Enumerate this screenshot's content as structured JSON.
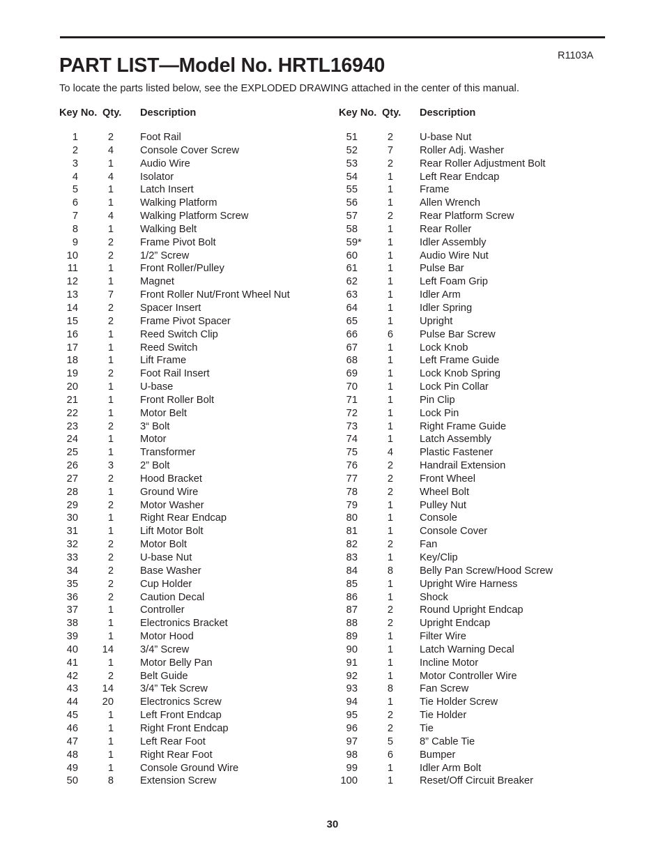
{
  "document": {
    "title": "PART LIST—Model No. HRTL16940",
    "revision": "R1103A",
    "intro": "To locate the parts listed below, see the EXPLODED DRAWING attached in the center of this manual.",
    "page_number": "30"
  },
  "table": {
    "headers": {
      "key_no": "Key No.",
      "qty": "Qty.",
      "description": "Description"
    },
    "left_column": [
      {
        "key": "1",
        "star": "",
        "qty": "2",
        "description": "Foot Rail"
      },
      {
        "key": "2",
        "star": "",
        "qty": "4",
        "description": "Console Cover Screw"
      },
      {
        "key": "3",
        "star": "",
        "qty": "1",
        "description": "Audio Wire"
      },
      {
        "key": "4",
        "star": "",
        "qty": "4",
        "description": "Isolator"
      },
      {
        "key": "5",
        "star": "",
        "qty": "1",
        "description": "Latch Insert"
      },
      {
        "key": "6",
        "star": "",
        "qty": "1",
        "description": "Walking Platform"
      },
      {
        "key": "7",
        "star": "",
        "qty": "4",
        "description": "Walking Platform Screw"
      },
      {
        "key": "8",
        "star": "",
        "qty": "1",
        "description": "Walking Belt"
      },
      {
        "key": "9",
        "star": "",
        "qty": "2",
        "description": "Frame Pivot Bolt"
      },
      {
        "key": "10",
        "star": "",
        "qty": "2",
        "description": "1/2” Screw"
      },
      {
        "key": "11",
        "star": "",
        "qty": "1",
        "description": "Front Roller/Pulley"
      },
      {
        "key": "12",
        "star": "",
        "qty": "1",
        "description": "Magnet"
      },
      {
        "key": "13",
        "star": "",
        "qty": "7",
        "description": "Front Roller Nut/Front Wheel Nut"
      },
      {
        "key": "14",
        "star": "",
        "qty": "2",
        "description": "Spacer Insert"
      },
      {
        "key": "15",
        "star": "",
        "qty": "2",
        "description": "Frame Pivot Spacer"
      },
      {
        "key": "16",
        "star": "",
        "qty": "1",
        "description": "Reed Switch Clip"
      },
      {
        "key": "17",
        "star": "",
        "qty": "1",
        "description": "Reed Switch"
      },
      {
        "key": "18",
        "star": "",
        "qty": "1",
        "description": "Lift Frame"
      },
      {
        "key": "19",
        "star": "",
        "qty": "2",
        "description": "Foot Rail Insert"
      },
      {
        "key": "20",
        "star": "",
        "qty": "1",
        "description": "U-base"
      },
      {
        "key": "21",
        "star": "",
        "qty": "1",
        "description": "Front Roller Bolt"
      },
      {
        "key": "22",
        "star": "",
        "qty": "1",
        "description": "Motor Belt"
      },
      {
        "key": "23",
        "star": "",
        "qty": "2",
        "description": "3“ Bolt"
      },
      {
        "key": "24",
        "star": "",
        "qty": "1",
        "description": "Motor"
      },
      {
        "key": "25",
        "star": "",
        "qty": "1",
        "description": "Transformer"
      },
      {
        "key": "26",
        "star": "",
        "qty": "3",
        "description": "2” Bolt"
      },
      {
        "key": "27",
        "star": "",
        "qty": "2",
        "description": "Hood Bracket"
      },
      {
        "key": "28",
        "star": "",
        "qty": "1",
        "description": "Ground Wire"
      },
      {
        "key": "29",
        "star": "",
        "qty": "2",
        "description": "Motor Washer"
      },
      {
        "key": "30",
        "star": "",
        "qty": "1",
        "description": "Right Rear Endcap"
      },
      {
        "key": "31",
        "star": "",
        "qty": "1",
        "description": "Lift Motor Bolt"
      },
      {
        "key": "32",
        "star": "",
        "qty": "2",
        "description": "Motor Bolt"
      },
      {
        "key": "33",
        "star": "",
        "qty": "2",
        "description": "U-base Nut"
      },
      {
        "key": "34",
        "star": "",
        "qty": "2",
        "description": "Base Washer"
      },
      {
        "key": "35",
        "star": "",
        "qty": "2",
        "description": "Cup Holder"
      },
      {
        "key": "36",
        "star": "",
        "qty": "2",
        "description": "Caution Decal"
      },
      {
        "key": "37",
        "star": "",
        "qty": "1",
        "description": "Controller"
      },
      {
        "key": "38",
        "star": "",
        "qty": "1",
        "description": "Electronics Bracket"
      },
      {
        "key": "39",
        "star": "",
        "qty": "1",
        "description": "Motor Hood"
      },
      {
        "key": "40",
        "star": "",
        "qty": "14",
        "description": "3/4” Screw"
      },
      {
        "key": "41",
        "star": "",
        "qty": "1",
        "description": "Motor Belly Pan"
      },
      {
        "key": "42",
        "star": "",
        "qty": "2",
        "description": "Belt Guide"
      },
      {
        "key": "43",
        "star": "",
        "qty": "14",
        "description": "3/4” Tek Screw"
      },
      {
        "key": "44",
        "star": "",
        "qty": "20",
        "description": "Electronics Screw"
      },
      {
        "key": "45",
        "star": "",
        "qty": "1",
        "description": "Left Front Endcap"
      },
      {
        "key": "46",
        "star": "",
        "qty": "1",
        "description": "Right Front Endcap"
      },
      {
        "key": "47",
        "star": "",
        "qty": "1",
        "description": "Left Rear Foot"
      },
      {
        "key": "48",
        "star": "",
        "qty": "1",
        "description": "Right Rear Foot"
      },
      {
        "key": "49",
        "star": "",
        "qty": "1",
        "description": "Console Ground Wire"
      },
      {
        "key": "50",
        "star": "",
        "qty": "8",
        "description": "Extension Screw"
      }
    ],
    "right_column": [
      {
        "key": "51",
        "star": "",
        "qty": "2",
        "description": "U-base Nut"
      },
      {
        "key": "52",
        "star": "",
        "qty": "7",
        "description": "Roller Adj. Washer"
      },
      {
        "key": "53",
        "star": "",
        "qty": "2",
        "description": "Rear Roller Adjustment Bolt"
      },
      {
        "key": "54",
        "star": "",
        "qty": "1",
        "description": "Left Rear Endcap"
      },
      {
        "key": "55",
        "star": "",
        "qty": "1",
        "description": "Frame"
      },
      {
        "key": "56",
        "star": "",
        "qty": "1",
        "description": "Allen Wrench"
      },
      {
        "key": "57",
        "star": "",
        "qty": "2",
        "description": "Rear Platform Screw"
      },
      {
        "key": "58",
        "star": "",
        "qty": "1",
        "description": "Rear Roller"
      },
      {
        "key": "59",
        "star": "*",
        "qty": "1",
        "description": "Idler Assembly"
      },
      {
        "key": "60",
        "star": "",
        "qty": "1",
        "description": "Audio Wire Nut"
      },
      {
        "key": "61",
        "star": "",
        "qty": "1",
        "description": "Pulse Bar"
      },
      {
        "key": "62",
        "star": "",
        "qty": "1",
        "description": "Left Foam Grip"
      },
      {
        "key": "63",
        "star": "",
        "qty": "1",
        "description": "Idler Arm"
      },
      {
        "key": "64",
        "star": "",
        "qty": "1",
        "description": "Idler Spring"
      },
      {
        "key": "65",
        "star": "",
        "qty": "1",
        "description": "Upright"
      },
      {
        "key": "66",
        "star": "",
        "qty": "6",
        "description": "Pulse Bar Screw"
      },
      {
        "key": "67",
        "star": "",
        "qty": "1",
        "description": "Lock Knob"
      },
      {
        "key": "68",
        "star": "",
        "qty": "1",
        "description": "Left Frame Guide"
      },
      {
        "key": "69",
        "star": "",
        "qty": "1",
        "description": "Lock Knob Spring"
      },
      {
        "key": "70",
        "star": "",
        "qty": "1",
        "description": "Lock Pin Collar"
      },
      {
        "key": "71",
        "star": "",
        "qty": "1",
        "description": "Pin Clip"
      },
      {
        "key": "72",
        "star": "",
        "qty": "1",
        "description": "Lock Pin"
      },
      {
        "key": "73",
        "star": "",
        "qty": "1",
        "description": "Right Frame Guide"
      },
      {
        "key": "74",
        "star": "",
        "qty": "1",
        "description": "Latch Assembly"
      },
      {
        "key": "75",
        "star": "",
        "qty": "4",
        "description": "Plastic Fastener"
      },
      {
        "key": "76",
        "star": "",
        "qty": "2",
        "description": "Handrail Extension"
      },
      {
        "key": "77",
        "star": "",
        "qty": "2",
        "description": "Front Wheel"
      },
      {
        "key": "78",
        "star": "",
        "qty": "2",
        "description": "Wheel Bolt"
      },
      {
        "key": "79",
        "star": "",
        "qty": "1",
        "description": "Pulley Nut"
      },
      {
        "key": "80",
        "star": "",
        "qty": "1",
        "description": "Console"
      },
      {
        "key": "81",
        "star": "",
        "qty": "1",
        "description": "Console Cover"
      },
      {
        "key": "82",
        "star": "",
        "qty": "2",
        "description": "Fan"
      },
      {
        "key": "83",
        "star": "",
        "qty": "1",
        "description": "Key/Clip"
      },
      {
        "key": "84",
        "star": "",
        "qty": "8",
        "description": "Belly Pan Screw/Hood Screw"
      },
      {
        "key": "85",
        "star": "",
        "qty": "1",
        "description": "Upright Wire Harness"
      },
      {
        "key": "86",
        "star": "",
        "qty": "1",
        "description": "Shock"
      },
      {
        "key": "87",
        "star": "",
        "qty": "2",
        "description": "Round Upright Endcap"
      },
      {
        "key": "88",
        "star": "",
        "qty": "2",
        "description": "Upright Endcap"
      },
      {
        "key": "89",
        "star": "",
        "qty": "1",
        "description": "Filter Wire"
      },
      {
        "key": "90",
        "star": "",
        "qty": "1",
        "description": "Latch Warning Decal"
      },
      {
        "key": "91",
        "star": "",
        "qty": "1",
        "description": "Incline Motor"
      },
      {
        "key": "92",
        "star": "",
        "qty": "1",
        "description": "Motor Controller Wire"
      },
      {
        "key": "93",
        "star": "",
        "qty": "8",
        "description": "Fan Screw"
      },
      {
        "key": "94",
        "star": "",
        "qty": "1",
        "description": "Tie Holder Screw"
      },
      {
        "key": "95",
        "star": "",
        "qty": "2",
        "description": "Tie Holder"
      },
      {
        "key": "96",
        "star": "",
        "qty": "2",
        "description": "Tie"
      },
      {
        "key": "97",
        "star": "",
        "qty": "5",
        "description": "8” Cable Tie"
      },
      {
        "key": "98",
        "star": "",
        "qty": "6",
        "description": "Bumper"
      },
      {
        "key": "99",
        "star": "",
        "qty": "1",
        "description": "Idler Arm Bolt"
      },
      {
        "key": "100",
        "star": "",
        "qty": "1",
        "description": "Reset/Off Circuit Breaker"
      }
    ]
  }
}
